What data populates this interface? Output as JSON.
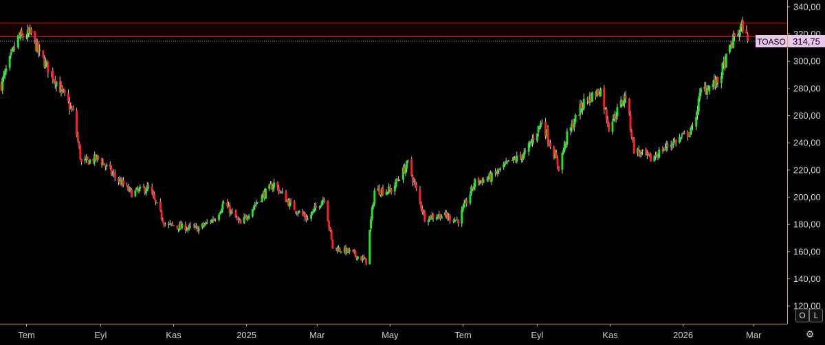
{
  "chart_data": {
    "type": "candlestick",
    "ticker": "TOASO",
    "last_price": "314,75",
    "y_ticks": [
      "340,00",
      "320,00",
      "300,00",
      "280,00",
      "260,00",
      "240,00",
      "220,00",
      "200,00",
      "180,00",
      "160,00",
      "140,00",
      "120,00"
    ],
    "y_tick_values": [
      340,
      320,
      300,
      280,
      260,
      240,
      220,
      200,
      180,
      160,
      140,
      120
    ],
    "ylim": [
      107,
      345
    ],
    "x_ticks": [
      "Tem",
      "Eyl",
      "Kas",
      "2025",
      "Mar",
      "May",
      "Tem",
      "Eyl",
      "Kas",
      "2026",
      "Mar"
    ],
    "x_tick_dates": [
      "2024-07",
      "2024-09",
      "2024-11",
      "2025-01",
      "2025-03",
      "2025-05",
      "2025-07",
      "2025-09",
      "2025-11",
      "2026-01",
      "2026-03"
    ],
    "resistance_zone": [
      318,
      328
    ],
    "close_path": [
      [
        "2024-06-10",
        283
      ],
      [
        "2024-06-24",
        317
      ],
      [
        "2024-07-05",
        320
      ],
      [
        "2024-07-12",
        305
      ],
      [
        "2024-07-26",
        285
      ],
      [
        "2024-08-09",
        262
      ],
      [
        "2024-08-16",
        225
      ],
      [
        "2024-08-30",
        229
      ],
      [
        "2024-09-13",
        215
      ],
      [
        "2024-09-27",
        203
      ],
      [
        "2024-10-11",
        207
      ],
      [
        "2024-10-25",
        180
      ],
      [
        "2024-11-08",
        178
      ],
      [
        "2024-11-22",
        177
      ],
      [
        "2024-12-06",
        185
      ],
      [
        "2024-12-13",
        196
      ],
      [
        "2024-12-27",
        180
      ],
      [
        "2025-01-10",
        197
      ],
      [
        "2025-01-24",
        210
      ],
      [
        "2025-02-07",
        194
      ],
      [
        "2025-02-21",
        184
      ],
      [
        "2025-03-07",
        200
      ],
      [
        "2025-03-14",
        163
      ],
      [
        "2025-03-28",
        160
      ],
      [
        "2025-04-11",
        153
      ],
      [
        "2025-04-18",
        205
      ],
      [
        "2025-05-02",
        205
      ],
      [
        "2025-05-16",
        225
      ],
      [
        "2025-05-30",
        185
      ],
      [
        "2025-06-13",
        187
      ],
      [
        "2025-06-27",
        183
      ],
      [
        "2025-07-11",
        211
      ],
      [
        "2025-07-25",
        215
      ],
      [
        "2025-08-08",
        225
      ],
      [
        "2025-08-22",
        232
      ],
      [
        "2025-09-05",
        256
      ],
      [
        "2025-09-19",
        222
      ],
      [
        "2025-09-26",
        245
      ],
      [
        "2025-10-10",
        270
      ],
      [
        "2025-10-24",
        279
      ],
      [
        "2025-10-31",
        252
      ],
      [
        "2025-11-14",
        275
      ],
      [
        "2025-11-21",
        235
      ],
      [
        "2025-12-05",
        228
      ],
      [
        "2025-12-19",
        238
      ],
      [
        "2026-01-02",
        245
      ],
      [
        "2026-01-09",
        250
      ],
      [
        "2026-01-16",
        278
      ],
      [
        "2026-01-30",
        285
      ],
      [
        "2026-02-13",
        318
      ],
      [
        "2026-02-20",
        326
      ],
      [
        "2026-02-24",
        314.75
      ]
    ]
  },
  "controls": {
    "log_label": "O",
    "linear_label": "L",
    "settings_icon": "settings-icon"
  },
  "colors": {
    "up": "#1ee61e",
    "down": "#ff1f1f",
    "zone": "#d11414",
    "axis": "#d6b13a",
    "tag": "#e8c7ea"
  }
}
